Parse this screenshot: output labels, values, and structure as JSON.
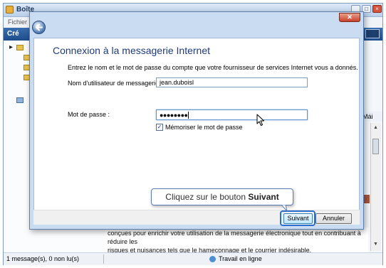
{
  "app": {
    "title_truncated": "Boîte",
    "menu_truncated": "Fichier",
    "create_truncated": "Cré",
    "list_header_truncated": "Mái",
    "preview_text_line1": "conçues pour enrichir votre utilisation de la messagerie électronique tout en contribuant à réduire les",
    "preview_text_line2": "risques et nuisances tels que le hameçonnage et le courrier indésirable.",
    "status_left": "1 message(s), 0 non lu(s)",
    "status_right": "Travail en ligne"
  },
  "dialog": {
    "heading": "Connexion à la messagerie Internet",
    "description": "Entrez le nom et le mot de passe du compte que votre fournisseur de services Internet vous a donnés.",
    "username_label": "Nom d'utilisateur de messagerie :",
    "username_value": "jean.duboisl",
    "password_label": "Mot de passe :",
    "password_mask": "●●●●●●●●",
    "remember_label": "Mémoriser le mot de passe",
    "remember_checked": true,
    "next_label": "Suivant",
    "cancel_label": "Annuler"
  },
  "callout": {
    "prefix": "Cliquez sur le bouton ",
    "emphasis": "Suivant"
  },
  "icons": {
    "back": "back-arrow-icon",
    "close": "close-icon",
    "cursor": "mouse-pointer-icon",
    "folder": "folder-icon"
  },
  "colors": {
    "heading": "#1f3b7a",
    "frame": "#c9dcf2",
    "toolbar": "#1d4c8a",
    "highlight": "#2a6fd0"
  }
}
